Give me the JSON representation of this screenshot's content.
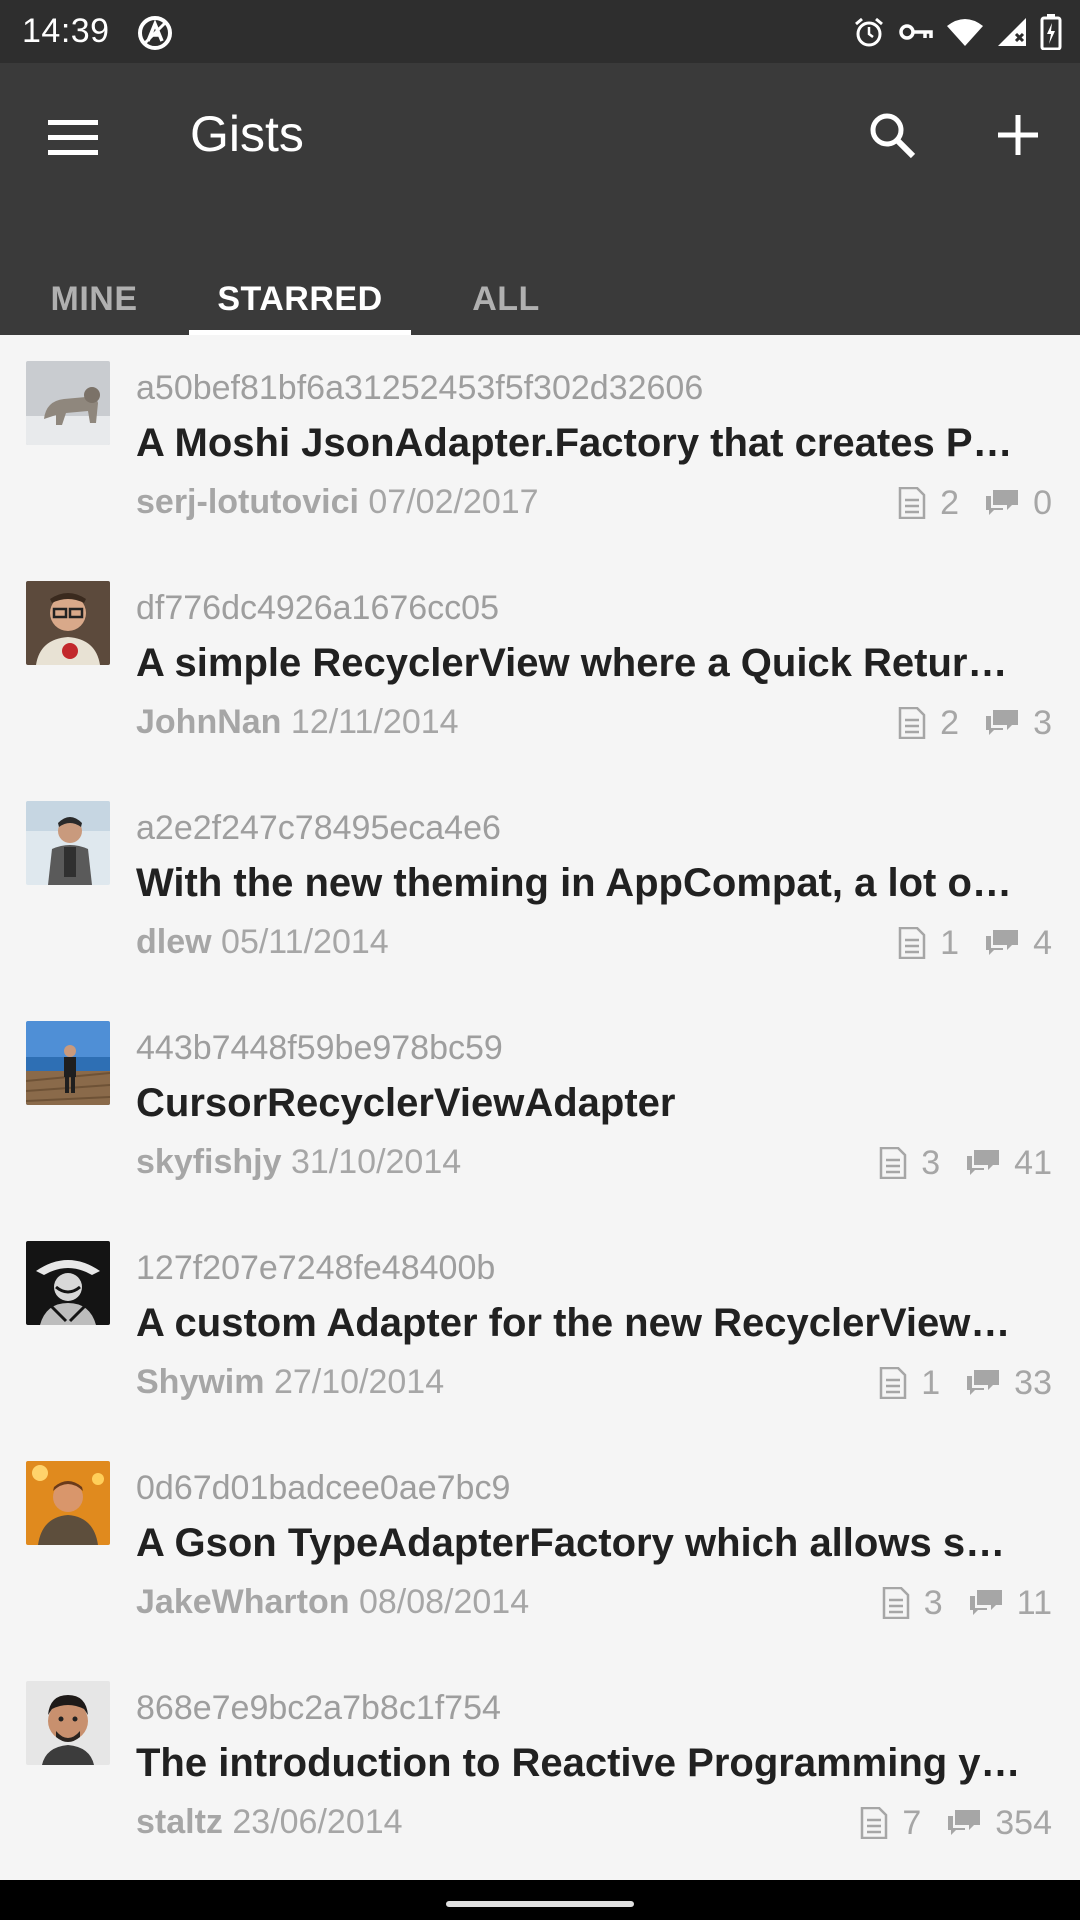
{
  "status_bar": {
    "time": "14:39",
    "left_icon": "circle-a-icon",
    "right_icons": [
      "alarm-icon",
      "vpn-key-icon",
      "wifi-icon",
      "signal-icon",
      "battery-charging-icon"
    ]
  },
  "app_bar": {
    "title": "Gists",
    "menu_icon": "hamburger-menu-icon",
    "search_icon": "search-icon",
    "add_icon": "add-icon",
    "background_color": "#3a3a3a"
  },
  "tabs": [
    {
      "label": "MINE",
      "active": false
    },
    {
      "label": "STARRED",
      "active": true
    },
    {
      "label": "ALL",
      "active": false
    }
  ],
  "gists": [
    {
      "id": "a50bef81bf6a31252453f5f302d32606",
      "title": "A Moshi JsonAdapter.Factory that creates P…",
      "author": "serj-lotutovici",
      "date": "07/02/2017",
      "files": "2",
      "comments": "0"
    },
    {
      "id": "df776dc4926a1676cc05",
      "title": "A simple RecyclerView where a Quick Retur…",
      "author": "JohnNan",
      "date": "12/11/2014",
      "files": "2",
      "comments": "3"
    },
    {
      "id": "a2e2f247c78495eca4e6",
      "title": "With the new theming in AppCompat, a lot o…",
      "author": "dlew",
      "date": "05/11/2014",
      "files": "1",
      "comments": "4"
    },
    {
      "id": "443b7448f59be978bc59",
      "title": "CursorRecyclerViewAdapter",
      "author": "skyfishjy",
      "date": "31/10/2014",
      "files": "3",
      "comments": "41"
    },
    {
      "id": "127f207e7248fe48400b",
      "title": "A custom Adapter for the new RecyclerView…",
      "author": "Shywim",
      "date": "27/10/2014",
      "files": "1",
      "comments": "33"
    },
    {
      "id": "0d67d01badcee0ae7bc9",
      "title": "A Gson TypeAdapterFactory which allows s…",
      "author": "JakeWharton",
      "date": "08/08/2014",
      "files": "3",
      "comments": "11"
    },
    {
      "id": "868e7e9bc2a7b8c1f754",
      "title": "The introduction to Reactive Programming y…",
      "author": "staltz",
      "date": "23/06/2014",
      "files": "7",
      "comments": "354"
    }
  ]
}
